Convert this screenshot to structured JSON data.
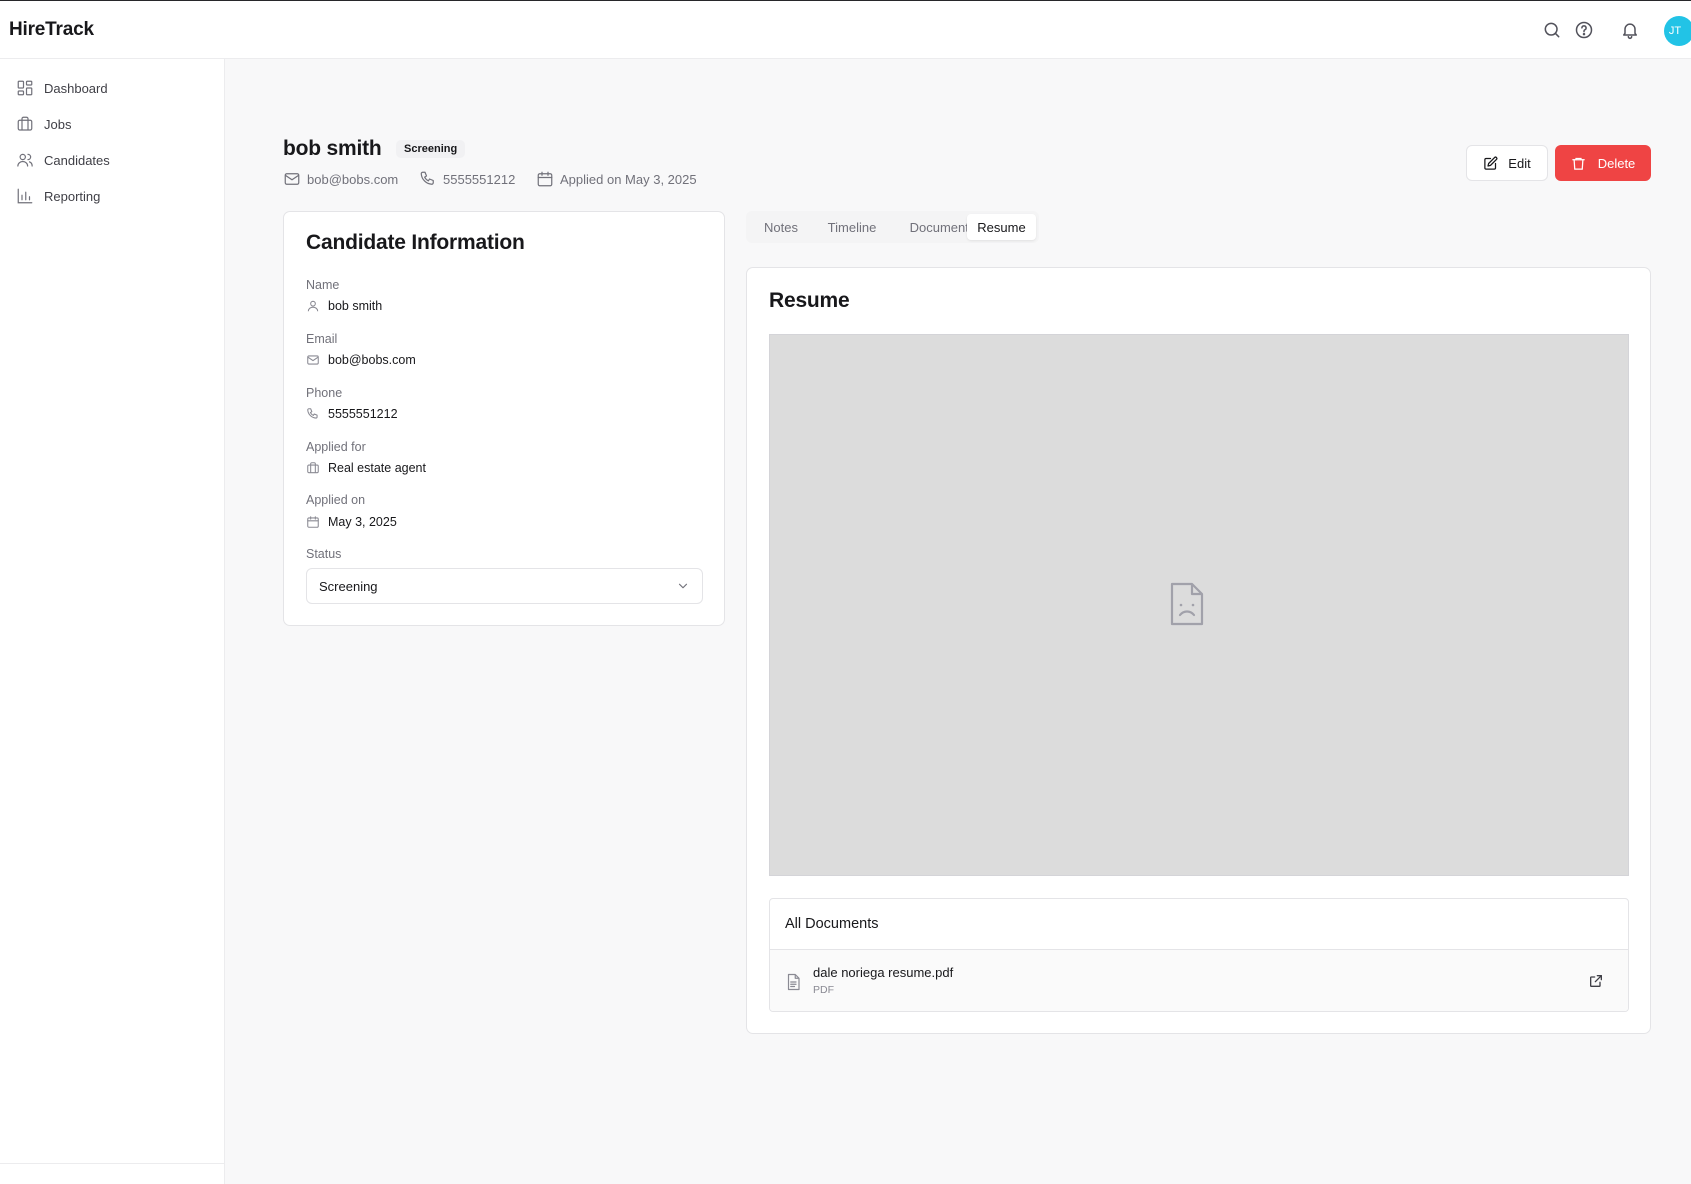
{
  "app": {
    "brand": "HireTrack"
  },
  "topbar": {
    "icons": [
      "search-icon",
      "help-icon",
      "bell-icon"
    ],
    "avatar_initials": "JT",
    "avatar_color": "#22c3e6"
  },
  "sidebar": {
    "items": [
      {
        "label": "Dashboard",
        "icon": "dashboard-icon"
      },
      {
        "label": "Jobs",
        "icon": "briefcase-icon"
      },
      {
        "label": "Candidates",
        "icon": "users-icon"
      },
      {
        "label": "Reporting",
        "icon": "bar-chart-icon"
      }
    ]
  },
  "candidate": {
    "name": "bob smith",
    "status_badge": "Screening",
    "email": "bob@bobs.com",
    "phone": "5555551212",
    "applied_text": "Applied on May 3, 2025"
  },
  "actions": {
    "edit": "Edit",
    "delete": "Delete",
    "delete_color": "#ef4444"
  },
  "info_card": {
    "title": "Candidate Information",
    "fields": [
      {
        "label": "Name",
        "value": "bob smith",
        "icon": "user-icon"
      },
      {
        "label": "Email",
        "value": "bob@bobs.com",
        "icon": "mail-icon"
      },
      {
        "label": "Phone",
        "value": "5555551212",
        "icon": "phone-icon"
      },
      {
        "label": "Applied for",
        "value": "Real estate agent",
        "icon": "briefcase-icon"
      },
      {
        "label": "Applied on",
        "value": "May 3, 2025",
        "icon": "calendar-icon"
      }
    ],
    "status_label": "Status",
    "status_value": "Screening"
  },
  "tabs": [
    {
      "label": "Notes",
      "active": false
    },
    {
      "label": "Timeline",
      "active": false
    },
    {
      "label": "Documents",
      "active": false
    },
    {
      "label": "Resume",
      "active": true
    }
  ],
  "resume": {
    "title": "Resume",
    "preview_icon": "broken-file-icon",
    "documents_title": "All Documents",
    "documents": [
      {
        "name": "dale noriega resume.pdf",
        "type": "PDF"
      }
    ]
  }
}
